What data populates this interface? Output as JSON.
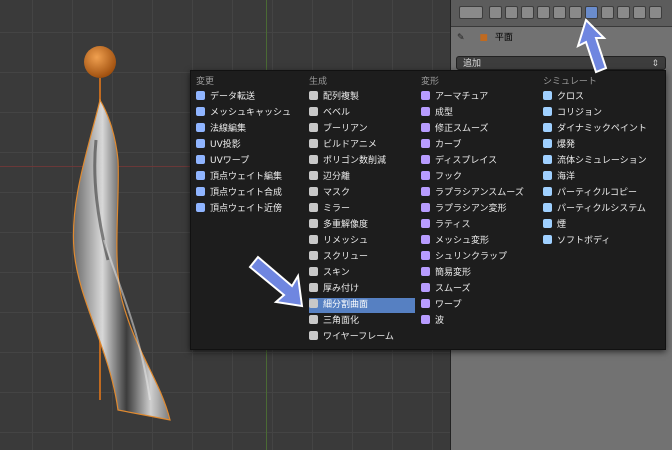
{
  "colors": {
    "menu_bg": "#1d1d1d",
    "highlight": "#5680c2",
    "arrow": "#6f86e0"
  },
  "properties": {
    "breadcrumb_label": "平面",
    "add_dropdown": "追加"
  },
  "menu": {
    "columns": [
      {
        "title": "変更",
        "items": [
          {
            "label": "データ転送",
            "icon": "data-transfer-icon"
          },
          {
            "label": "メッシュキャッシュ",
            "icon": "mesh-cache-icon"
          },
          {
            "label": "法線編集",
            "icon": "normal-edit-icon"
          },
          {
            "label": "UV投影",
            "icon": "uv-project-icon"
          },
          {
            "label": "UVワープ",
            "icon": "uv-warp-icon"
          },
          {
            "label": "頂点ウェイト編集",
            "icon": "vertex-weight-edit-icon"
          },
          {
            "label": "頂点ウェイト合成",
            "icon": "vertex-weight-mix-icon"
          },
          {
            "label": "頂点ウェイト近傍",
            "icon": "vertex-weight-proximity-icon"
          }
        ]
      },
      {
        "title": "生成",
        "items": [
          {
            "label": "配列複製",
            "icon": "array-icon"
          },
          {
            "label": "ベベル",
            "icon": "bevel-icon"
          },
          {
            "label": "ブーリアン",
            "icon": "boolean-icon"
          },
          {
            "label": "ビルドアニメ",
            "icon": "build-icon"
          },
          {
            "label": "ポリゴン数削減",
            "icon": "decimate-icon"
          },
          {
            "label": "辺分離",
            "icon": "edge-split-icon"
          },
          {
            "label": "マスク",
            "icon": "mask-icon"
          },
          {
            "label": "ミラー",
            "icon": "mirror-icon"
          },
          {
            "label": "多重解像度",
            "icon": "multires-icon"
          },
          {
            "label": "リメッシュ",
            "icon": "remesh-icon"
          },
          {
            "label": "スクリュー",
            "icon": "screw-icon"
          },
          {
            "label": "スキン",
            "icon": "skin-icon"
          },
          {
            "label": "厚み付け",
            "icon": "solidify-icon"
          },
          {
            "label": "細分割曲面",
            "icon": "subsurf-icon",
            "selected": true
          },
          {
            "label": "三角面化",
            "icon": "triangulate-icon"
          },
          {
            "label": "ワイヤーフレーム",
            "icon": "wireframe-icon"
          }
        ]
      },
      {
        "title": "変形",
        "items": [
          {
            "label": "アーマチュア",
            "icon": "armature-icon"
          },
          {
            "label": "成型",
            "icon": "cast-icon"
          },
          {
            "label": "修正スムーズ",
            "icon": "corrective-smooth-icon"
          },
          {
            "label": "カーブ",
            "icon": "curve-icon"
          },
          {
            "label": "ディスプレイス",
            "icon": "displace-icon"
          },
          {
            "label": "フック",
            "icon": "hook-icon"
          },
          {
            "label": "ラプラシアンスムーズ",
            "icon": "laplacian-smooth-icon"
          },
          {
            "label": "ラプラシアン変形",
            "icon": "laplacian-deform-icon"
          },
          {
            "label": "ラティス",
            "icon": "lattice-icon"
          },
          {
            "label": "メッシュ変形",
            "icon": "mesh-deform-icon"
          },
          {
            "label": "シュリンクラップ",
            "icon": "shrinkwrap-icon"
          },
          {
            "label": "簡易変形",
            "icon": "simple-deform-icon"
          },
          {
            "label": "スムーズ",
            "icon": "smooth-icon"
          },
          {
            "label": "ワープ",
            "icon": "warp-icon"
          },
          {
            "label": "波",
            "icon": "wave-icon"
          }
        ]
      },
      {
        "title": "シミュレート",
        "items": [
          {
            "label": "クロス",
            "icon": "cloth-icon"
          },
          {
            "label": "コリジョン",
            "icon": "collision-icon"
          },
          {
            "label": "ダイナミックペイント",
            "icon": "dynamic-paint-icon"
          },
          {
            "label": "爆発",
            "icon": "explode-icon"
          },
          {
            "label": "流体シミュレーション",
            "icon": "fluid-icon"
          },
          {
            "label": "海洋",
            "icon": "ocean-icon"
          },
          {
            "label": "パーティクルコピー",
            "icon": "particle-instance-icon"
          },
          {
            "label": "パーティクルシステム",
            "icon": "particle-system-icon"
          },
          {
            "label": "煙",
            "icon": "smoke-icon"
          },
          {
            "label": "ソフトボディ",
            "icon": "soft-body-icon"
          }
        ]
      }
    ]
  }
}
